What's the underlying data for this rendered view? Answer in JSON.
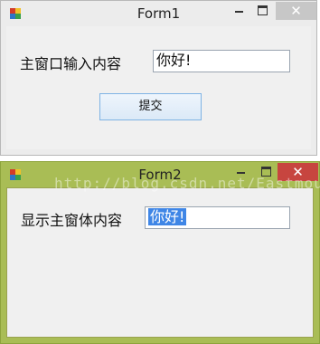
{
  "form1": {
    "title": "Form1",
    "close_glyph": "✕",
    "label": "主窗口输入内容",
    "input_value": "你好!",
    "submit_label": "提交"
  },
  "form2": {
    "title": "Form2",
    "close_glyph": "✕",
    "label": "显示主窗体内容",
    "textbox_value": "你好!"
  },
  "watermark": "http://blog.csdn.net/Eastmount",
  "colors": {
    "form2_frame": "#a9bd55",
    "form2_close": "#c7453f",
    "selection": "#3f86e6",
    "button_border": "#7eb3e4"
  },
  "icons": [
    "app-form-icon",
    "minimize-icon",
    "maximize-icon",
    "close-icon"
  ]
}
